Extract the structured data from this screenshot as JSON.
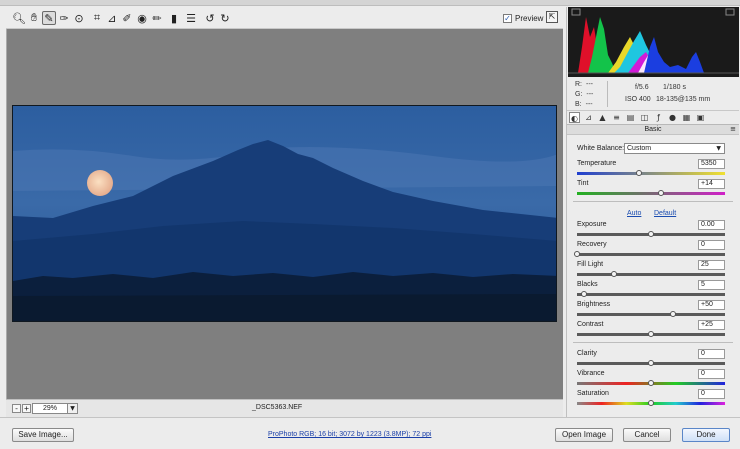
{
  "toolbar": {
    "tools": [
      {
        "name": "zoom-tool",
        "glyph": "🔍︎"
      },
      {
        "name": "hand-tool",
        "glyph": "✋︎"
      },
      {
        "name": "white-balance-tool",
        "glyph": "✎"
      },
      {
        "name": "color-sampler-tool",
        "glyph": "✑"
      },
      {
        "name": "targeted-adjustment-tool",
        "glyph": "⊙"
      },
      {
        "name": "crop-tool",
        "glyph": "⌗"
      },
      {
        "name": "straighten-tool",
        "glyph": "⊿"
      },
      {
        "name": "spot-removal-tool",
        "glyph": "✐"
      },
      {
        "name": "red-eye-tool",
        "glyph": "◉"
      },
      {
        "name": "adjustment-brush-tool",
        "glyph": "✏"
      },
      {
        "name": "graduated-filter-tool",
        "glyph": "▮"
      },
      {
        "name": "preferences-tool",
        "glyph": "☰"
      },
      {
        "name": "rotate-ccw-tool",
        "glyph": "↺"
      },
      {
        "name": "rotate-cw-tool",
        "glyph": "↻"
      }
    ],
    "preview_label": "Preview",
    "preview_checked": true
  },
  "status": {
    "zoom_out": "-",
    "zoom_in": "+",
    "zoom_value": "29%",
    "filename": "_DSC5363.NEF"
  },
  "info": {
    "r_label": "R:",
    "r_value": "---",
    "g_label": "G:",
    "g_value": "---",
    "b_label": "B:",
    "b_value": "---",
    "aperture": "f/5.6",
    "shutter": "1/180 s",
    "iso": "ISO 400",
    "lens": "18-135@135 mm"
  },
  "panel": {
    "section_title": "Basic",
    "white_balance_label": "White Balance:",
    "white_balance_value": "Custom",
    "auto_link": "Auto",
    "default_link": "Default",
    "sliders": {
      "temperature": {
        "label": "Temperature",
        "value": "5350",
        "pos": 0.42
      },
      "tint": {
        "label": "Tint",
        "value": "+14",
        "pos": 0.57
      },
      "exposure": {
        "label": "Exposure",
        "value": "0.00",
        "pos": 0.5
      },
      "recovery": {
        "label": "Recovery",
        "value": "0",
        "pos": 0.0
      },
      "fill_light": {
        "label": "Fill Light",
        "value": "25",
        "pos": 0.25
      },
      "blacks": {
        "label": "Blacks",
        "value": "5",
        "pos": 0.05
      },
      "brightness": {
        "label": "Brightness",
        "value": "+50",
        "pos": 0.65
      },
      "contrast": {
        "label": "Contrast",
        "value": "+25",
        "pos": 0.5
      },
      "clarity": {
        "label": "Clarity",
        "value": "0",
        "pos": 0.5
      },
      "vibrance": {
        "label": "Vibrance",
        "value": "0",
        "pos": 0.5
      },
      "saturation": {
        "label": "Saturation",
        "value": "0",
        "pos": 0.5
      }
    }
  },
  "bottom": {
    "save_image": "Save Image...",
    "workflow": "ProPhoto RGB; 16 bit; 3072 by 1223 (3.8MP); 72 ppi",
    "open_image": "Open Image",
    "cancel": "Cancel",
    "done": "Done"
  },
  "colors": {
    "accent": "#1a4cb0",
    "canvas": "#7f7f7f",
    "histogram_bg": "#1a1a1a"
  }
}
